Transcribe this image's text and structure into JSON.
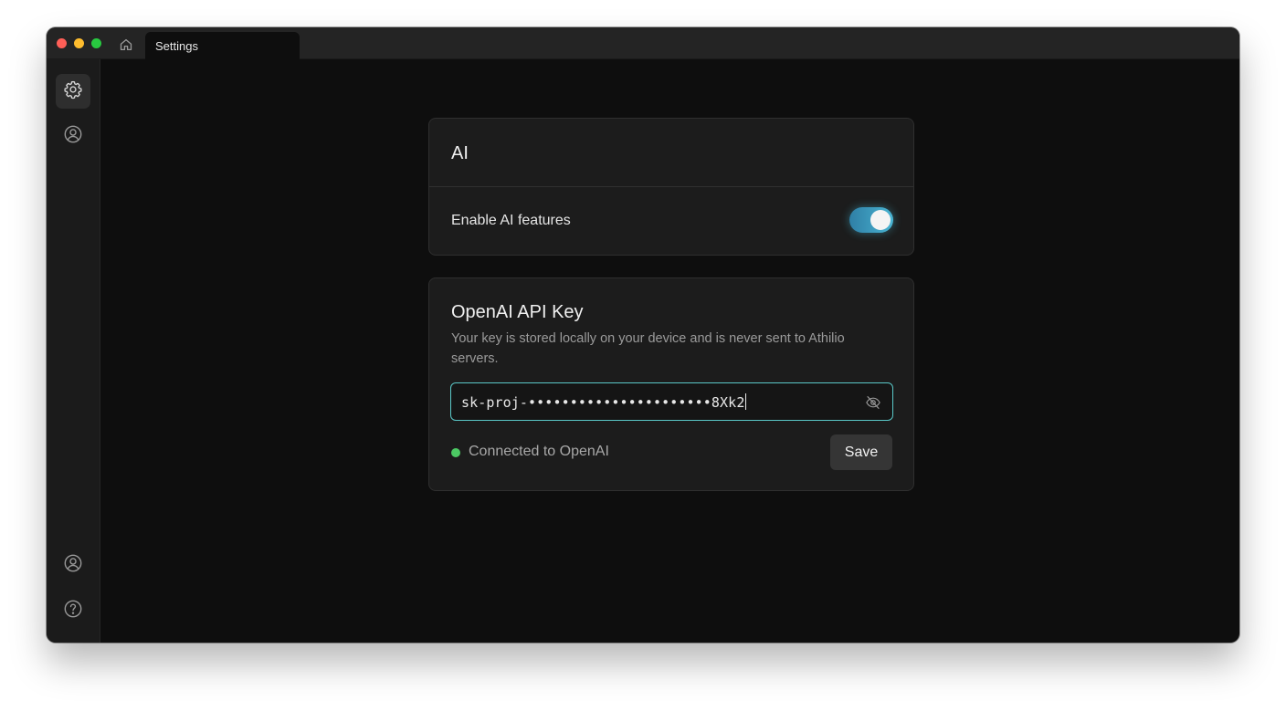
{
  "window": {
    "tab_label": "Settings",
    "home_icon": "home-icon"
  },
  "sidebar": {
    "items": [
      {
        "name": "settings",
        "icon": "gear-icon",
        "active": true
      },
      {
        "name": "profile",
        "icon": "user-circle-icon",
        "active": false
      },
      {
        "name": "account",
        "icon": "user-circle-icon",
        "active": false
      },
      {
        "name": "help",
        "icon": "question-circle-icon",
        "active": false
      }
    ]
  },
  "ai_section": {
    "title": "AI",
    "toggle_label": "Enable AI features",
    "toggle_on": true
  },
  "api_key_section": {
    "title": "OpenAI API Key",
    "description": "Your key is stored locally on your device and is never sent to Athilio servers.",
    "input_value": "sk-proj-••••••••••••••••••••••8Xk2",
    "visibility_icon": "eye-off-icon",
    "status_text": "Connected to OpenAI",
    "status_color": "#4cc963",
    "save_label": "Save"
  },
  "colors": {
    "accent": "#5ac8c8",
    "toggle": "#49b4d2"
  }
}
